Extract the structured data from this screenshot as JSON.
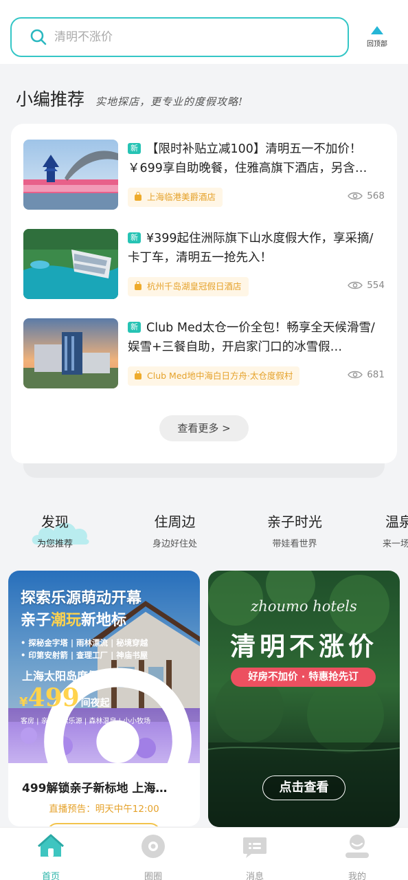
{
  "header": {
    "search_placeholder": "清明不涨价",
    "to_top_label": "回顶部"
  },
  "editor_section": {
    "title": "小编推荐",
    "slogan": "实地探店，更专业的度假攻略!",
    "new_badge": "新",
    "items": [
      {
        "title": "【限时补贴立减100】清明五一不加价！￥699享自助晚餐，住雅高旗下酒店，另含…",
        "hotel": "上海临港美爵酒店",
        "views": "568"
      },
      {
        "title": "¥399起住洲际旗下山水度假大作，享采摘/卡丁车，清明五一抢先入！",
        "hotel": "杭州千岛湖皇冠假日酒店",
        "views": "554"
      },
      {
        "title": "Club Med太仓一价全包！畅享全天候滑雪/娱雪+三餐自助，开启家门口的冰雪假…",
        "hotel": "Club Med地中海白日方舟·太仓度假村",
        "views": "681"
      }
    ],
    "more_label": "查看更多 >"
  },
  "categories": [
    {
      "name": "发现",
      "sub": "为您推荐",
      "active": true
    },
    {
      "name": "住周边",
      "sub": "身边好住处",
      "active": false
    },
    {
      "name": "亲子时光",
      "sub": "带娃看世界",
      "active": false
    },
    {
      "name": "温泉",
      "sub": "来一场",
      "active": false
    }
  ],
  "feature_left": {
    "poster_line1": "探索乐源萌动开幕",
    "poster_line2_a": "亲子",
    "poster_line2_b": "潮玩",
    "poster_line2_c": "新地标",
    "poster_list1": "• 探秘金字塔 | 雨林漂流 | 秘境穿越",
    "poster_list2": "• 印第安射箭 | 查理工厂 | 神庙书屋",
    "poster_location": "上海太阳岛度假酒店",
    "price_currency": "¥",
    "price_value": "499",
    "price_unit": "间夜起",
    "poster_tags": "客房 | 亲子探索乐源 | 森林温泉 | 小小牧场",
    "title": "499解锁亲子新标地 上海…",
    "subtitle": "直播预告：明天中午12:00"
  },
  "feature_right": {
    "script": "zhoumo hotels",
    "headline": "清明不涨价",
    "pill": "好房不加价 · 特惠抢先订",
    "button": "点击查看"
  },
  "bottom_nav": [
    {
      "label": "首页",
      "icon": "home-icon",
      "active": true
    },
    {
      "label": "圈圈",
      "icon": "circle-icon",
      "active": false
    },
    {
      "label": "消息",
      "icon": "message-icon",
      "active": false
    },
    {
      "label": "我的",
      "icon": "profile-icon",
      "active": false
    }
  ],
  "colors": {
    "accent": "#34c6c6",
    "new_badge": "#26c3b4",
    "hotel_tag": "#e5a22b",
    "promo_pill": "#ec5060",
    "nav_active": "#28b3a8"
  }
}
